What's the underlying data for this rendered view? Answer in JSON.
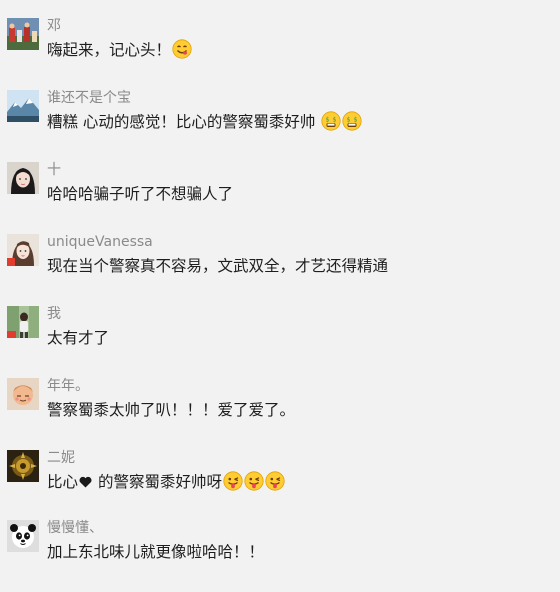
{
  "comments": [
    {
      "name": "邓",
      "text": "嗨起来，记心头！",
      "emoji": "yum-face-icon"
    },
    {
      "name": "谁还不是个宝",
      "text": "糟糕 心动的感觉！比心的警察蜀黍好帅 ",
      "emoji": "money-mouth-face-icon"
    },
    {
      "name": "十",
      "text": "哈哈哈骗子听了不想骗人了"
    },
    {
      "name": "uniqueVanessa",
      "text": "现在当个警察真不容易，文武双全，才艺还得精通"
    },
    {
      "name": "我",
      "text": "太有才了"
    },
    {
      "name": "年年。",
      "text": "警察蜀黍太帅了叭！！！爱了爱了。"
    },
    {
      "name": "二妮",
      "text_before": "比心",
      "text_after": " 的警察蜀黍好帅呀",
      "emoji": "winking-tongue-face-icon"
    },
    {
      "name": "慢慢懂、",
      "text": "加上东北味儿就更像啦哈哈！！"
    }
  ]
}
